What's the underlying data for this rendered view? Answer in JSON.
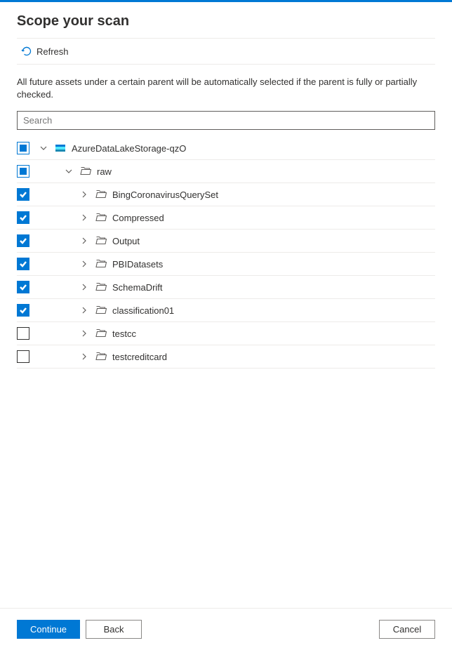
{
  "header": {
    "title": "Scope your scan",
    "refresh_label": "Refresh"
  },
  "description": "All future assets under a certain parent will be automatically selected if the parent is fully or partially checked.",
  "search": {
    "placeholder": "Search"
  },
  "tree": {
    "root": {
      "label": "AzureDataLakeStorage-qzO",
      "state": "indeterminate",
      "expanded": true
    },
    "raw": {
      "label": "raw",
      "state": "indeterminate",
      "expanded": true
    },
    "children": [
      {
        "label": "BingCoronavirusQuerySet",
        "state": "checked"
      },
      {
        "label": "Compressed",
        "state": "checked"
      },
      {
        "label": "Output",
        "state": "checked"
      },
      {
        "label": "PBIDatasets",
        "state": "checked"
      },
      {
        "label": "SchemaDrift",
        "state": "checked"
      },
      {
        "label": "classification01",
        "state": "checked"
      },
      {
        "label": "testcc",
        "state": "unchecked"
      },
      {
        "label": "testcreditcard",
        "state": "unchecked"
      }
    ]
  },
  "footer": {
    "continue_label": "Continue",
    "back_label": "Back",
    "cancel_label": "Cancel"
  }
}
